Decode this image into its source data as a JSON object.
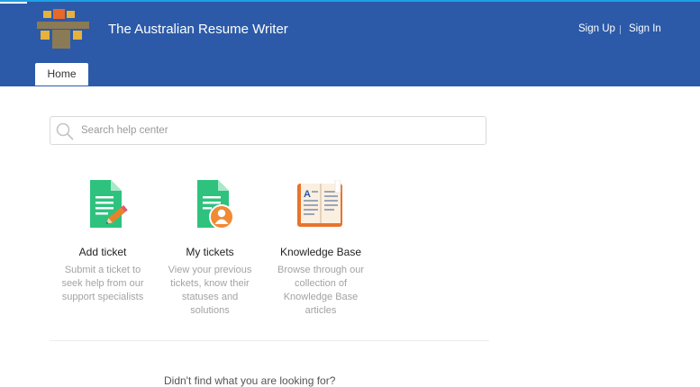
{
  "header": {
    "brand": "The Australian Resume Writer",
    "sign_up": "Sign Up",
    "sign_in": "Sign In",
    "home_tab": "Home",
    "colors": {
      "bar": "#2c5aa8",
      "top_line": "#1ea0e6"
    }
  },
  "search": {
    "placeholder": "Search help center",
    "icon": "search-icon"
  },
  "cards": [
    {
      "icon": "add-ticket-icon",
      "title": "Add ticket",
      "desc": "Submit a ticket to seek help from our support specialists"
    },
    {
      "icon": "my-tickets-icon",
      "title": "My tickets",
      "desc": "View your previous tickets, know their statuses and solutions"
    },
    {
      "icon": "knowledge-base-icon",
      "title": "Knowledge Base",
      "desc": "Browse through our collection of Knowledge Base articles"
    }
  ],
  "footer_text": "Didn't find what you are looking for?"
}
